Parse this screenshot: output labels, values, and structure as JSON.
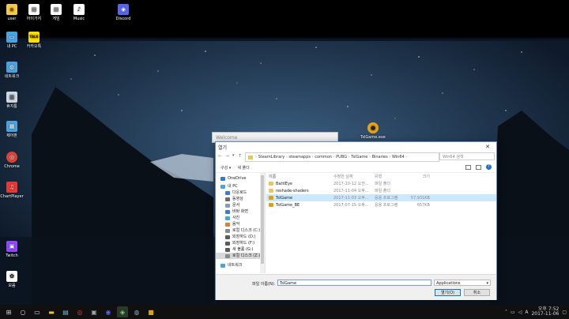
{
  "desktop": {
    "icons": [
      {
        "label": "user",
        "color": "#f2c94c",
        "glyph": "▪"
      },
      {
        "label": "어이가지",
        "color": "#ffffff",
        "glyph": "▤"
      },
      {
        "label": "게임",
        "color": "#ffffff",
        "glyph": "▤"
      },
      {
        "label": "Music",
        "color": "#ffffff",
        "glyph": "♪"
      },
      {
        "label": "Discord",
        "color": "#5865f2",
        "glyph": "◉"
      },
      {
        "label": "내 PC",
        "color": "#4aa3df",
        "glyph": "▭"
      },
      {
        "label": "카카오톡",
        "color": "#f9e000",
        "glyph": "TALK"
      },
      {
        "label": "네트워크",
        "color": "#4aa3df",
        "glyph": "◍"
      },
      {
        "label": "휴지통",
        "color": "#cfd8e3",
        "glyph": "▥"
      },
      {
        "label": "제어판",
        "color": "#4aa3df",
        "glyph": "▦"
      },
      {
        "label": "Chrome",
        "color": "#db4437",
        "glyph": "◎"
      },
      {
        "label": "ChartPlayer",
        "color": "#e53935",
        "glyph": "♫"
      },
      {
        "label": "Twitch",
        "color": "#9146ff",
        "glyph": "▣"
      },
      {
        "label": "모음",
        "color": "#ffffff",
        "glyph": "✿"
      }
    ],
    "floating_icon_label": "TslGame.exe"
  },
  "background_window": {
    "title": "Welcome"
  },
  "dialog": {
    "title": "열기",
    "close_glyph": "✕",
    "breadcrumb": [
      "SteamLibrary",
      "steamapps",
      "common",
      "PUBG",
      "TslGame",
      "Binaries",
      "Win64"
    ],
    "search_placeholder": "Win64 검색",
    "toolbar": {
      "organize": "구성 ▾",
      "new_folder": "새 폴더"
    },
    "nav_items": [
      {
        "label": "OneDrive",
        "color": "#2f7bd6"
      },
      {
        "label": "내 PC",
        "color": "#4aa3df"
      },
      {
        "label": "다운로드",
        "color": "#3a7bd5"
      },
      {
        "label": "동영상",
        "color": "#6b6b6b"
      },
      {
        "label": "문서",
        "color": "#8a9bb0"
      },
      {
        "label": "바탕 화면",
        "color": "#3a7bd5"
      },
      {
        "label": "사진",
        "color": "#4aa3df"
      },
      {
        "label": "음악",
        "color": "#e07b39"
      },
      {
        "label": "로컬 디스크 (C:)",
        "color": "#8a8a8a"
      },
      {
        "label": "외장하드 (D:)",
        "color": "#5a5a5a"
      },
      {
        "label": "외장하드 (F:)",
        "color": "#5a5a5a"
      },
      {
        "label": "새 볼륨 (G:)",
        "color": "#5a5a5a"
      },
      {
        "label": "로컬 디스크 (Z:)",
        "color": "#8a8a8a"
      },
      {
        "label": "네트워크",
        "color": "#4aa3df"
      }
    ],
    "columns": {
      "name": "이름",
      "date": "수정한 날짜",
      "type": "유형",
      "size": "크기"
    },
    "files": [
      {
        "name": "BattlEye",
        "date": "2017-10-12 오전...",
        "type": "파일 폴더",
        "size": "",
        "kind": "folder",
        "selected": false
      },
      {
        "name": "reshade-shaders",
        "date": "2017-11-04 오후...",
        "type": "파일 폴더",
        "size": "",
        "kind": "folder",
        "selected": false
      },
      {
        "name": "TslGame",
        "date": "2017-11-03 오후...",
        "type": "응용 프로그램",
        "size": "57,931KB",
        "kind": "app",
        "selected": true
      },
      {
        "name": "TslGame_BE",
        "date": "2017-07-15 오후...",
        "type": "응용 프로그램",
        "size": "657KB",
        "kind": "app",
        "selected": false
      }
    ],
    "filename_label": "파일 이름(N):",
    "filename_value": "TslGame",
    "filetype_value": "Applications",
    "open_button": "열기(O)",
    "cancel_button": "취소"
  },
  "taskbar": {
    "time": "오후 7:52",
    "date": "2017-11-06",
    "ime": "A"
  }
}
